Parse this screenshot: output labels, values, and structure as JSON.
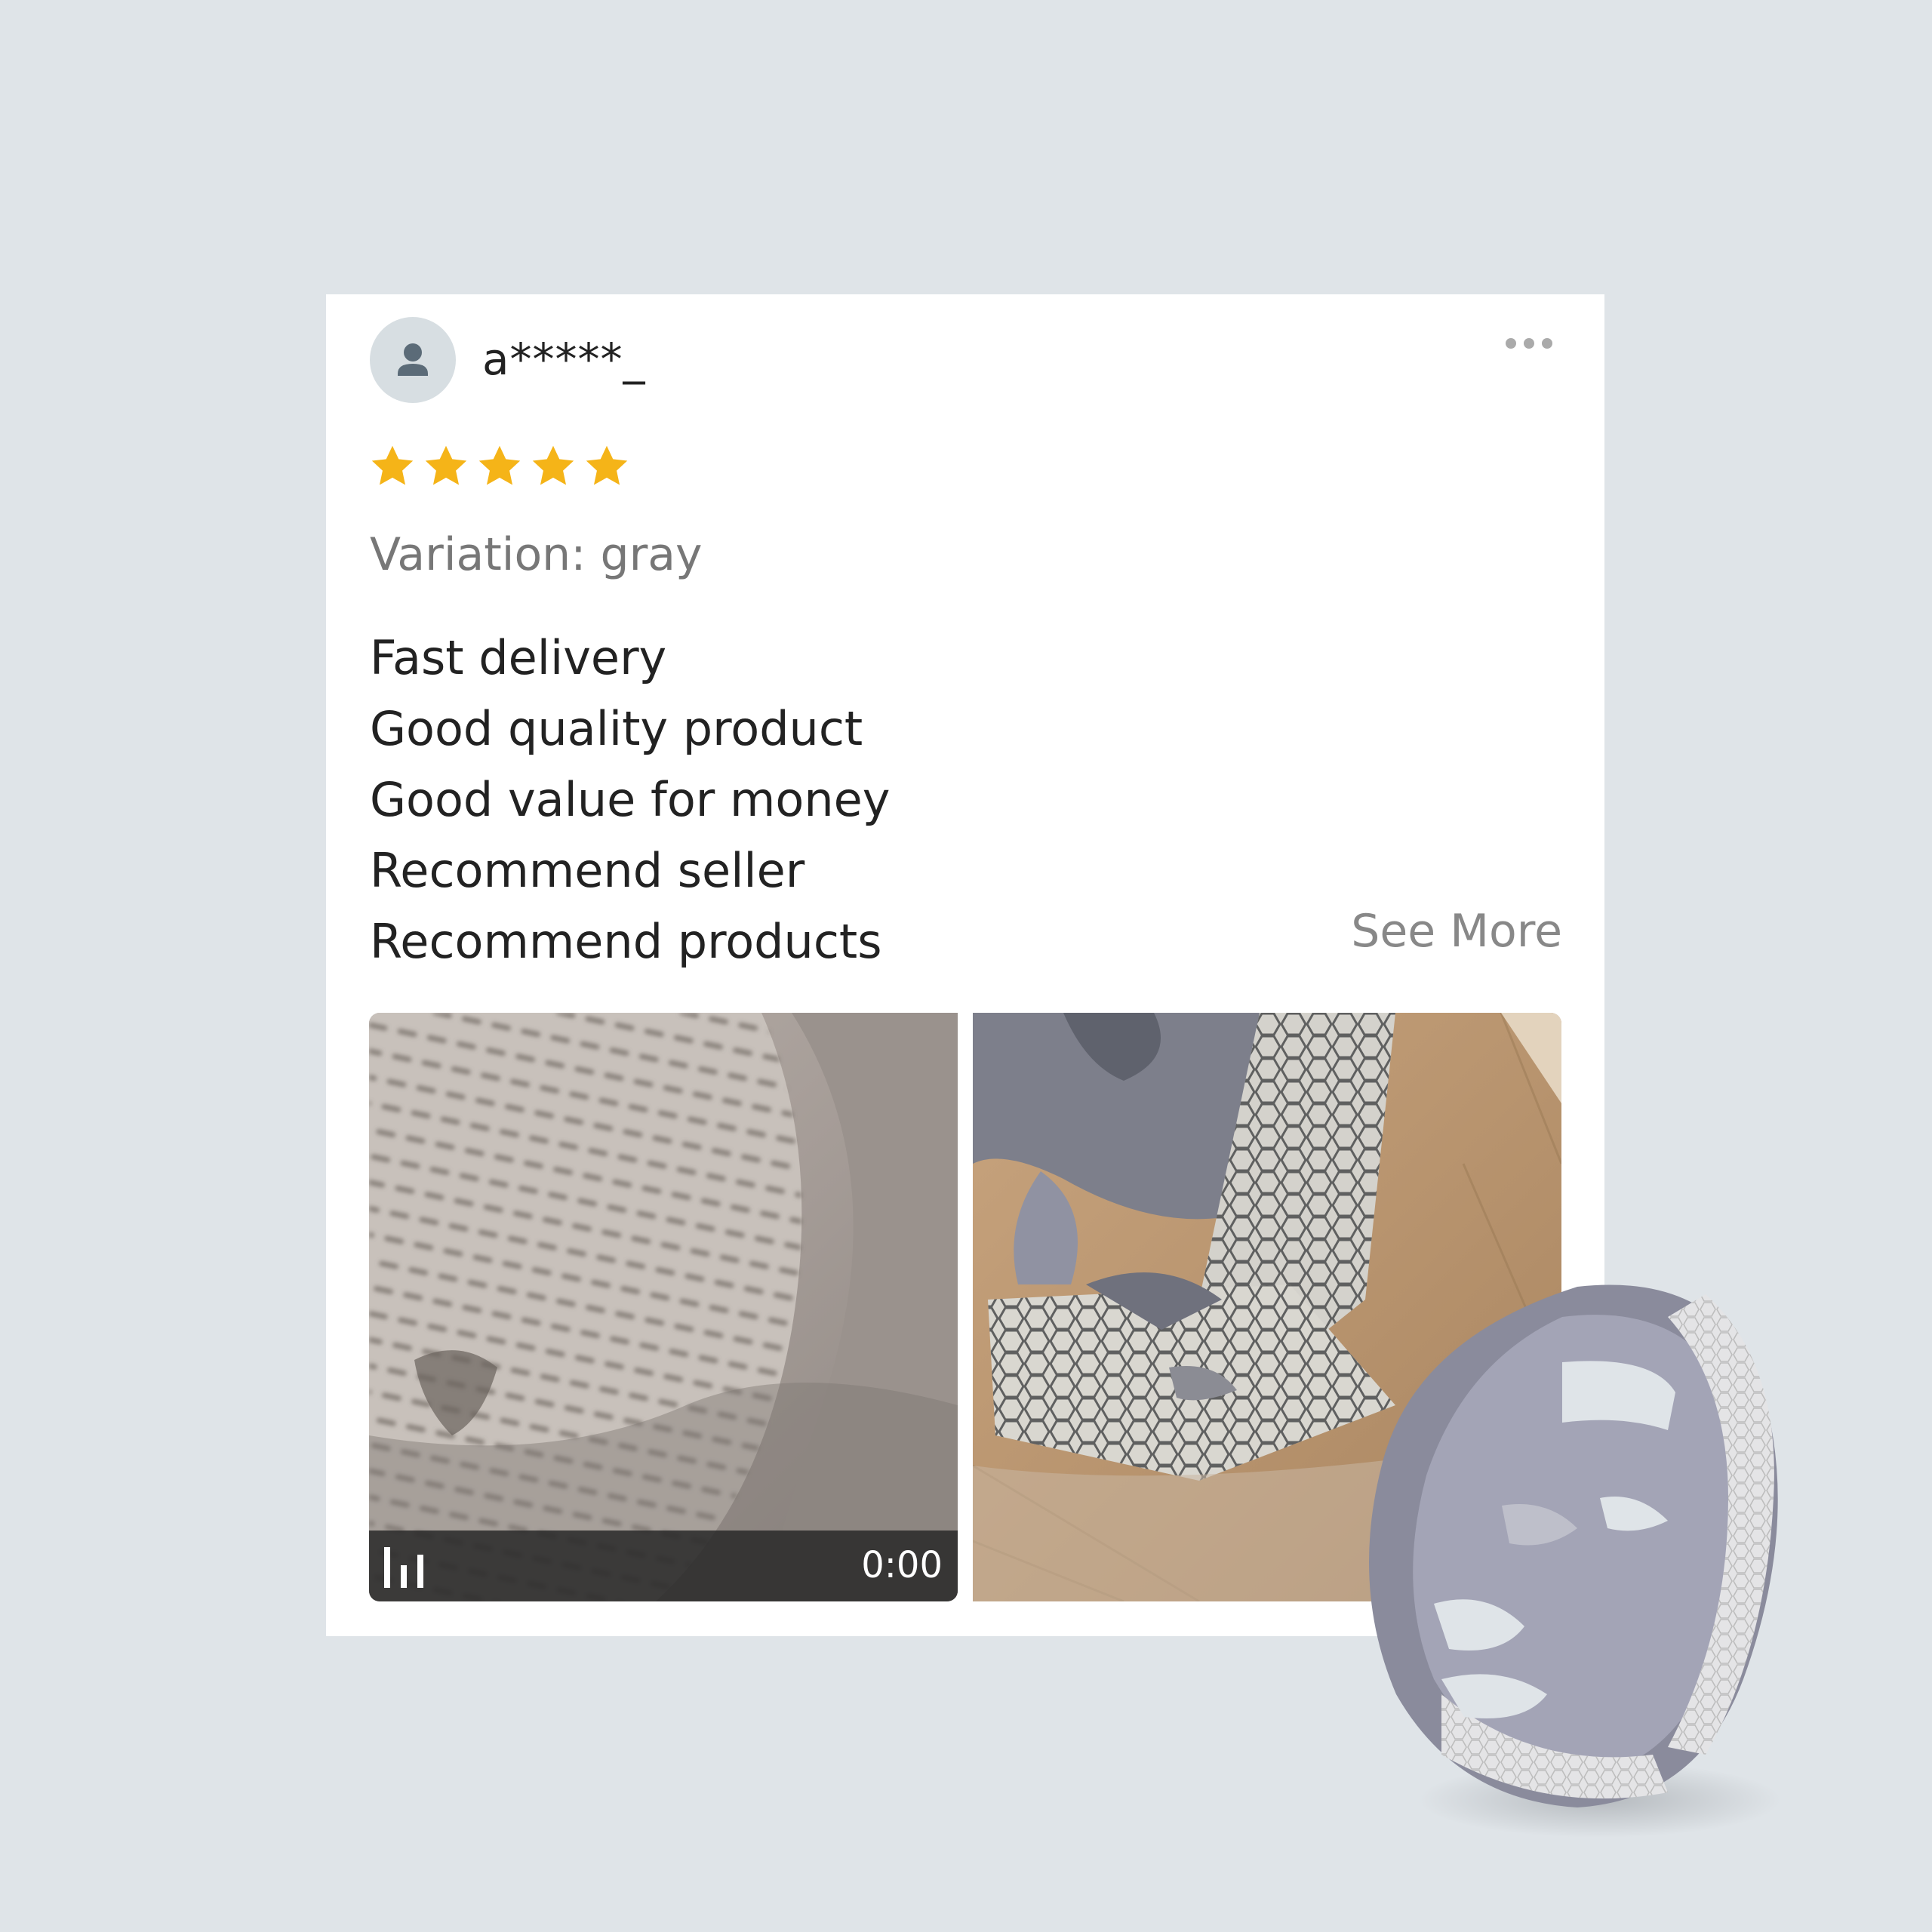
{
  "review": {
    "username": "a*****_",
    "rating": 5,
    "rating_max": 5,
    "variation": "Variation: gray",
    "lines": [
      "Fast delivery",
      "Good quality product",
      "Good value for money",
      "Recommend seller",
      "Recommend products"
    ],
    "see_more": "See More",
    "video_time": "0:00"
  },
  "icons": {
    "avatar": "person-icon",
    "more": "more-horizontal-icon",
    "star": "star-icon",
    "video": "equalizer-icon"
  },
  "colors": {
    "background": "#dfe4e8",
    "star": "#f5b418",
    "secondary_text": "#777777",
    "see_more": "#888888"
  }
}
